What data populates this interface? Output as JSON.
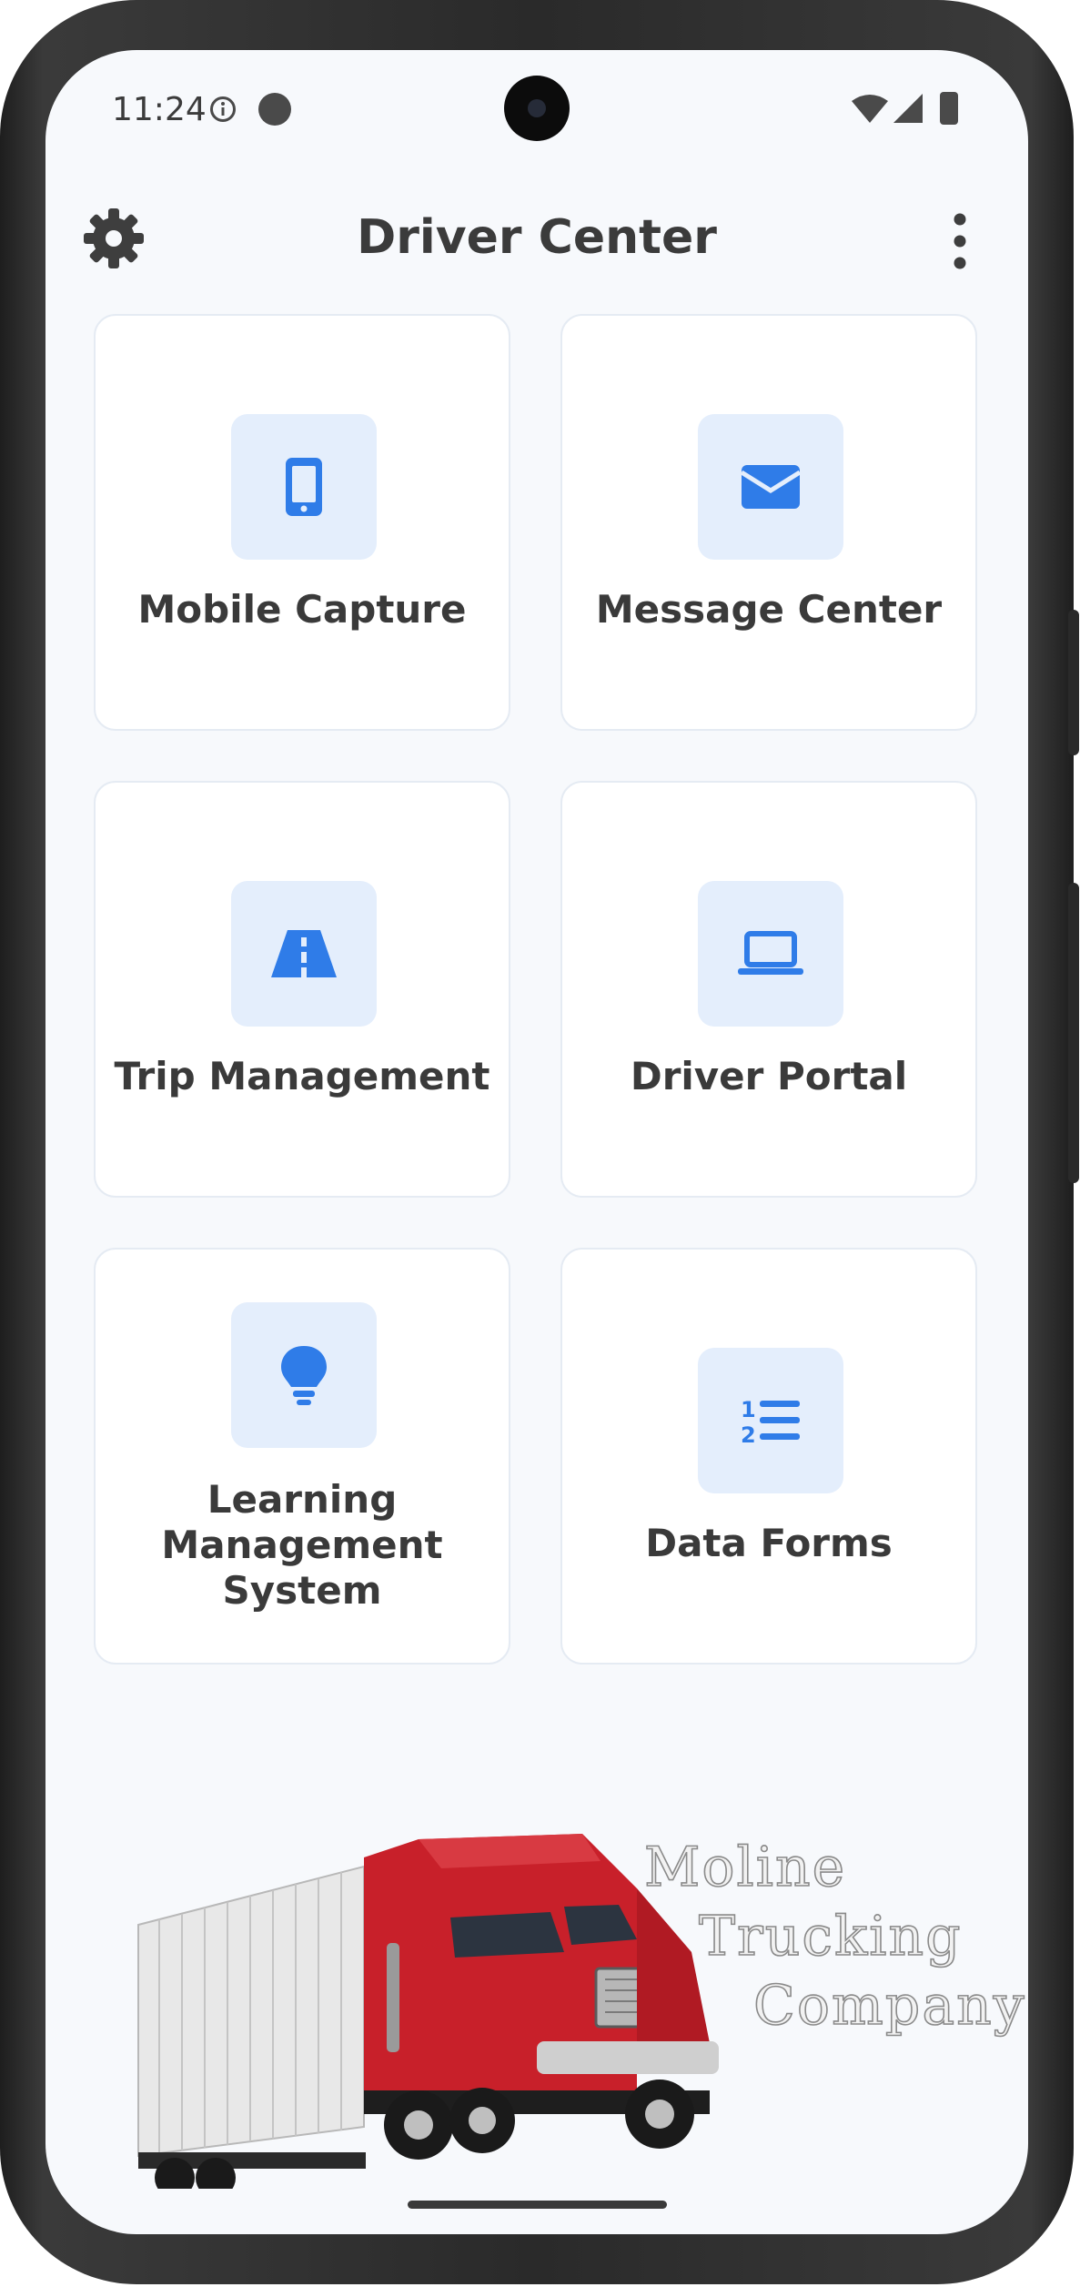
{
  "status_bar": {
    "time": "11:24",
    "icons": [
      "info-icon",
      "notification-dot-icon",
      "wifi-icon",
      "signal-icon",
      "battery-icon"
    ]
  },
  "header": {
    "title": "Driver Center",
    "left_icon": "gear-icon",
    "right_icon": "more-vertical-icon"
  },
  "menu": {
    "items": [
      {
        "label": "Mobile Capture",
        "icon": "mobile-phone-icon"
      },
      {
        "label": "Message Center",
        "icon": "envelope-icon"
      },
      {
        "label": "Trip Management",
        "icon": "road-icon"
      },
      {
        "label": "Driver Portal",
        "icon": "laptop-icon"
      },
      {
        "label": "Learning Management System",
        "icon": "lightbulb-icon"
      },
      {
        "label": "Data Forms",
        "icon": "numbered-list-icon"
      }
    ]
  },
  "brand": {
    "line1": "Moline",
    "line2": "Trucking",
    "line3": "Company"
  },
  "colors": {
    "accent": "#2f7ce8",
    "icon_tile_bg": "#e4eefc",
    "screen_bg": "#f7f9fc",
    "truck_red": "#c8202a"
  }
}
